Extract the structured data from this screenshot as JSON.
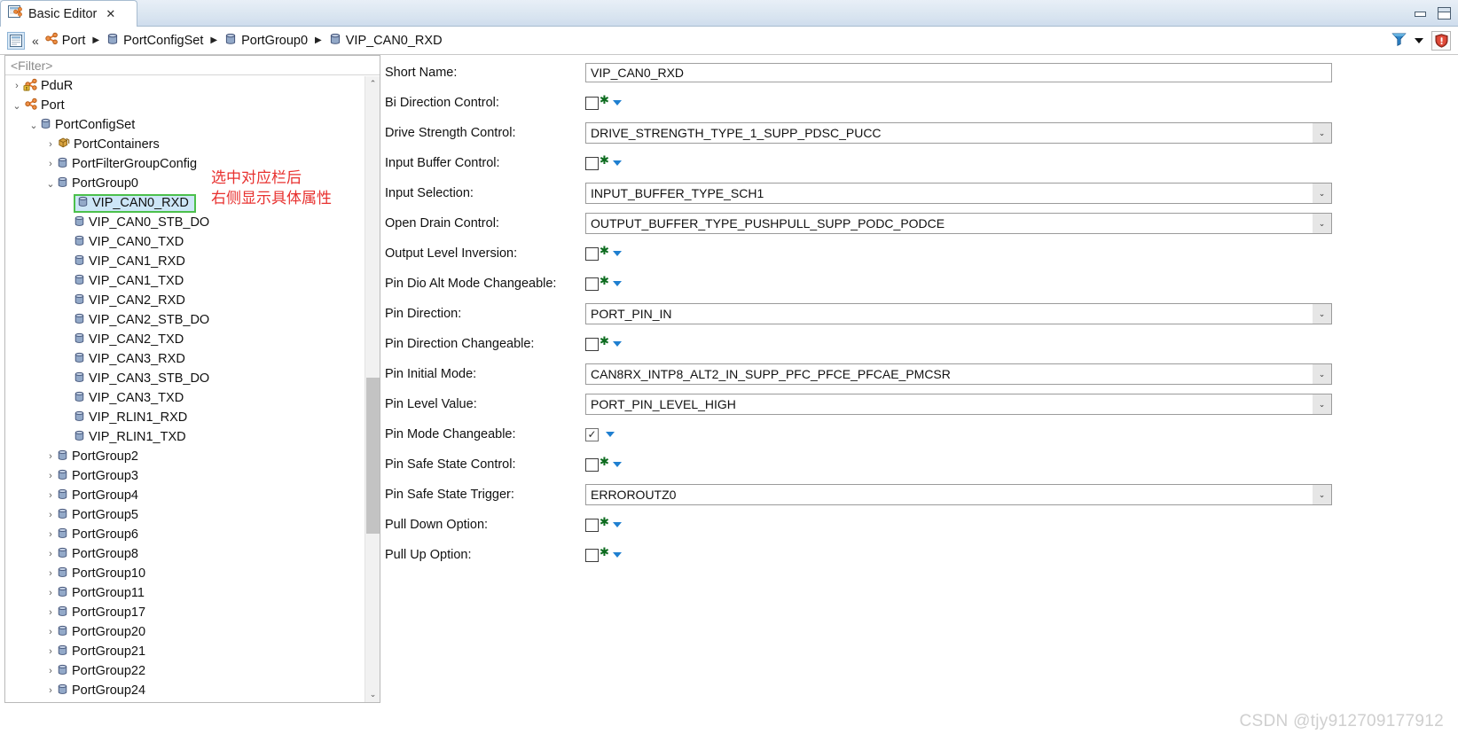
{
  "window": {
    "tab_title": "Basic Editor",
    "tab_close_glyph": "✕",
    "minimize_label": "Minimize",
    "maximize_label": "Maximize"
  },
  "breadcrumb": {
    "home_icon": "editor-icon",
    "collapse_glyph": "«",
    "separator": "▶",
    "items": [
      {
        "label": "Port",
        "icon": "module-icon"
      },
      {
        "label": "PortConfigSet",
        "icon": "container-icon"
      },
      {
        "label": "PortGroup0",
        "icon": "container-icon"
      },
      {
        "label": "VIP_CAN0_RXD",
        "icon": "container-icon"
      }
    ],
    "tools": {
      "filter_icon": "filter-icon",
      "dropdown_icon": "chevron-down-icon",
      "validate_icon": "shield-icon"
    }
  },
  "tree": {
    "filter_placeholder": "<Filter>",
    "scroll_up_glyph": "⌃",
    "scroll_down_glyph": "⌄",
    "expanded_glyph": "⌄",
    "collapsed_glyph": "›",
    "items": [
      {
        "label": "PduR",
        "indent": 0,
        "twist": "collapsed",
        "icon": "module-warning-icon",
        "selected": false
      },
      {
        "label": "Port",
        "indent": 0,
        "twist": "expanded",
        "icon": "module-icon",
        "selected": false
      },
      {
        "label": "PortConfigSet",
        "indent": 1,
        "twist": "expanded",
        "icon": "container-icon",
        "selected": false
      },
      {
        "label": "PortContainers",
        "indent": 2,
        "twist": "collapsed",
        "icon": "package-icon",
        "selected": false
      },
      {
        "label": "PortFilterGroupConfig",
        "indent": 2,
        "twist": "collapsed",
        "icon": "container-icon",
        "selected": false
      },
      {
        "label": "PortGroup0",
        "indent": 2,
        "twist": "expanded",
        "icon": "container-icon",
        "selected": false
      },
      {
        "label": "VIP_CAN0_RXD",
        "indent": 3,
        "twist": "none",
        "icon": "container-icon",
        "selected": true
      },
      {
        "label": "VIP_CAN0_STB_DO",
        "indent": 3,
        "twist": "none",
        "icon": "container-icon",
        "selected": false
      },
      {
        "label": "VIP_CAN0_TXD",
        "indent": 3,
        "twist": "none",
        "icon": "container-icon",
        "selected": false
      },
      {
        "label": "VIP_CAN1_RXD",
        "indent": 3,
        "twist": "none",
        "icon": "container-icon",
        "selected": false
      },
      {
        "label": "VIP_CAN1_TXD",
        "indent": 3,
        "twist": "none",
        "icon": "container-icon",
        "selected": false
      },
      {
        "label": "VIP_CAN2_RXD",
        "indent": 3,
        "twist": "none",
        "icon": "container-icon",
        "selected": false
      },
      {
        "label": "VIP_CAN2_STB_DO",
        "indent": 3,
        "twist": "none",
        "icon": "container-icon",
        "selected": false
      },
      {
        "label": "VIP_CAN2_TXD",
        "indent": 3,
        "twist": "none",
        "icon": "container-icon",
        "selected": false
      },
      {
        "label": "VIP_CAN3_RXD",
        "indent": 3,
        "twist": "none",
        "icon": "container-icon",
        "selected": false
      },
      {
        "label": "VIP_CAN3_STB_DO",
        "indent": 3,
        "twist": "none",
        "icon": "container-icon",
        "selected": false
      },
      {
        "label": "VIP_CAN3_TXD",
        "indent": 3,
        "twist": "none",
        "icon": "container-icon",
        "selected": false
      },
      {
        "label": "VIP_RLIN1_RXD",
        "indent": 3,
        "twist": "none",
        "icon": "container-icon",
        "selected": false
      },
      {
        "label": "VIP_RLIN1_TXD",
        "indent": 3,
        "twist": "none",
        "icon": "container-icon",
        "selected": false
      },
      {
        "label": "PortGroup2",
        "indent": 2,
        "twist": "collapsed",
        "icon": "container-icon",
        "selected": false
      },
      {
        "label": "PortGroup3",
        "indent": 2,
        "twist": "collapsed",
        "icon": "container-icon",
        "selected": false
      },
      {
        "label": "PortGroup4",
        "indent": 2,
        "twist": "collapsed",
        "icon": "container-icon",
        "selected": false
      },
      {
        "label": "PortGroup5",
        "indent": 2,
        "twist": "collapsed",
        "icon": "container-icon",
        "selected": false
      },
      {
        "label": "PortGroup6",
        "indent": 2,
        "twist": "collapsed",
        "icon": "container-icon",
        "selected": false
      },
      {
        "label": "PortGroup8",
        "indent": 2,
        "twist": "collapsed",
        "icon": "container-icon",
        "selected": false
      },
      {
        "label": "PortGroup10",
        "indent": 2,
        "twist": "collapsed",
        "icon": "container-icon",
        "selected": false
      },
      {
        "label": "PortGroup11",
        "indent": 2,
        "twist": "collapsed",
        "icon": "container-icon",
        "selected": false
      },
      {
        "label": "PortGroup17",
        "indent": 2,
        "twist": "collapsed",
        "icon": "container-icon",
        "selected": false
      },
      {
        "label": "PortGroup20",
        "indent": 2,
        "twist": "collapsed",
        "icon": "container-icon",
        "selected": false
      },
      {
        "label": "PortGroup21",
        "indent": 2,
        "twist": "collapsed",
        "icon": "container-icon",
        "selected": false
      },
      {
        "label": "PortGroup22",
        "indent": 2,
        "twist": "collapsed",
        "icon": "container-icon",
        "selected": false
      },
      {
        "label": "PortGroup24",
        "indent": 2,
        "twist": "collapsed",
        "icon": "container-icon",
        "selected": false
      }
    ]
  },
  "annotation": {
    "line1": "选中对应栏后",
    "line2": "右侧显示具体属性",
    "color": "#e8312f"
  },
  "properties": {
    "fields": [
      {
        "label": "Short Name:",
        "type": "text",
        "value": "VIP_CAN0_RXD",
        "required": false,
        "checked": false
      },
      {
        "label": "Bi Direction Control:",
        "type": "checkbox",
        "value": "",
        "required": true,
        "checked": false
      },
      {
        "label": "Drive Strength Control:",
        "type": "combo",
        "value": "DRIVE_STRENGTH_TYPE_1_SUPP_PDSC_PUCC",
        "required": true,
        "checked": false
      },
      {
        "label": "Input Buffer Control:",
        "type": "checkbox",
        "value": "",
        "required": true,
        "checked": false
      },
      {
        "label": "Input Selection:",
        "type": "combo",
        "value": "INPUT_BUFFER_TYPE_SCH1",
        "required": true,
        "checked": false
      },
      {
        "label": "Open Drain Control:",
        "type": "combo",
        "value": "OUTPUT_BUFFER_TYPE_PUSHPULL_SUPP_PODC_PODCE",
        "required": true,
        "checked": false
      },
      {
        "label": "Output Level Inversion:",
        "type": "checkbox",
        "value": "",
        "required": true,
        "checked": false
      },
      {
        "label": "Pin Dio Alt Mode Changeable:",
        "type": "checkbox",
        "value": "",
        "required": true,
        "checked": false
      },
      {
        "label": "Pin Direction:",
        "type": "combo",
        "value": "PORT_PIN_IN",
        "required": true,
        "checked": false
      },
      {
        "label": "Pin Direction Changeable:",
        "type": "checkbox",
        "value": "",
        "required": true,
        "checked": false
      },
      {
        "label": "Pin Initial Mode:",
        "type": "combo",
        "value": "CAN8RX_INTP8_ALT2_IN_SUPP_PFC_PFCE_PFCAE_PMCSR",
        "required": false,
        "checked": false
      },
      {
        "label": "Pin Level Value:",
        "type": "combo",
        "value": "PORT_PIN_LEVEL_HIGH",
        "required": false,
        "checked": false
      },
      {
        "label": "Pin Mode Changeable:",
        "type": "checkbox",
        "value": "",
        "required": false,
        "checked": true
      },
      {
        "label": "Pin Safe State Control:",
        "type": "checkbox",
        "value": "",
        "required": true,
        "checked": false
      },
      {
        "label": "Pin Safe State Trigger:",
        "type": "combo",
        "value": "ERROROUTZ0",
        "required": true,
        "checked": false
      },
      {
        "label": "Pull Down Option:",
        "type": "checkbox",
        "value": "",
        "required": true,
        "checked": false
      },
      {
        "label": "Pull Up Option:",
        "type": "checkbox",
        "value": "",
        "required": true,
        "checked": false
      }
    ],
    "checkbox_check_glyph": "✓",
    "combo_arrow_glyph": "⌄",
    "required_marker": "✱"
  },
  "watermark": "CSDN @tjy912709177912",
  "colors": {
    "selection_bg": "#cde6f7",
    "selection_border": "#4cc04c",
    "required_green": "#0c6b1e",
    "caret_blue": "#1f7fd0",
    "annotation_red": "#e8312f"
  }
}
